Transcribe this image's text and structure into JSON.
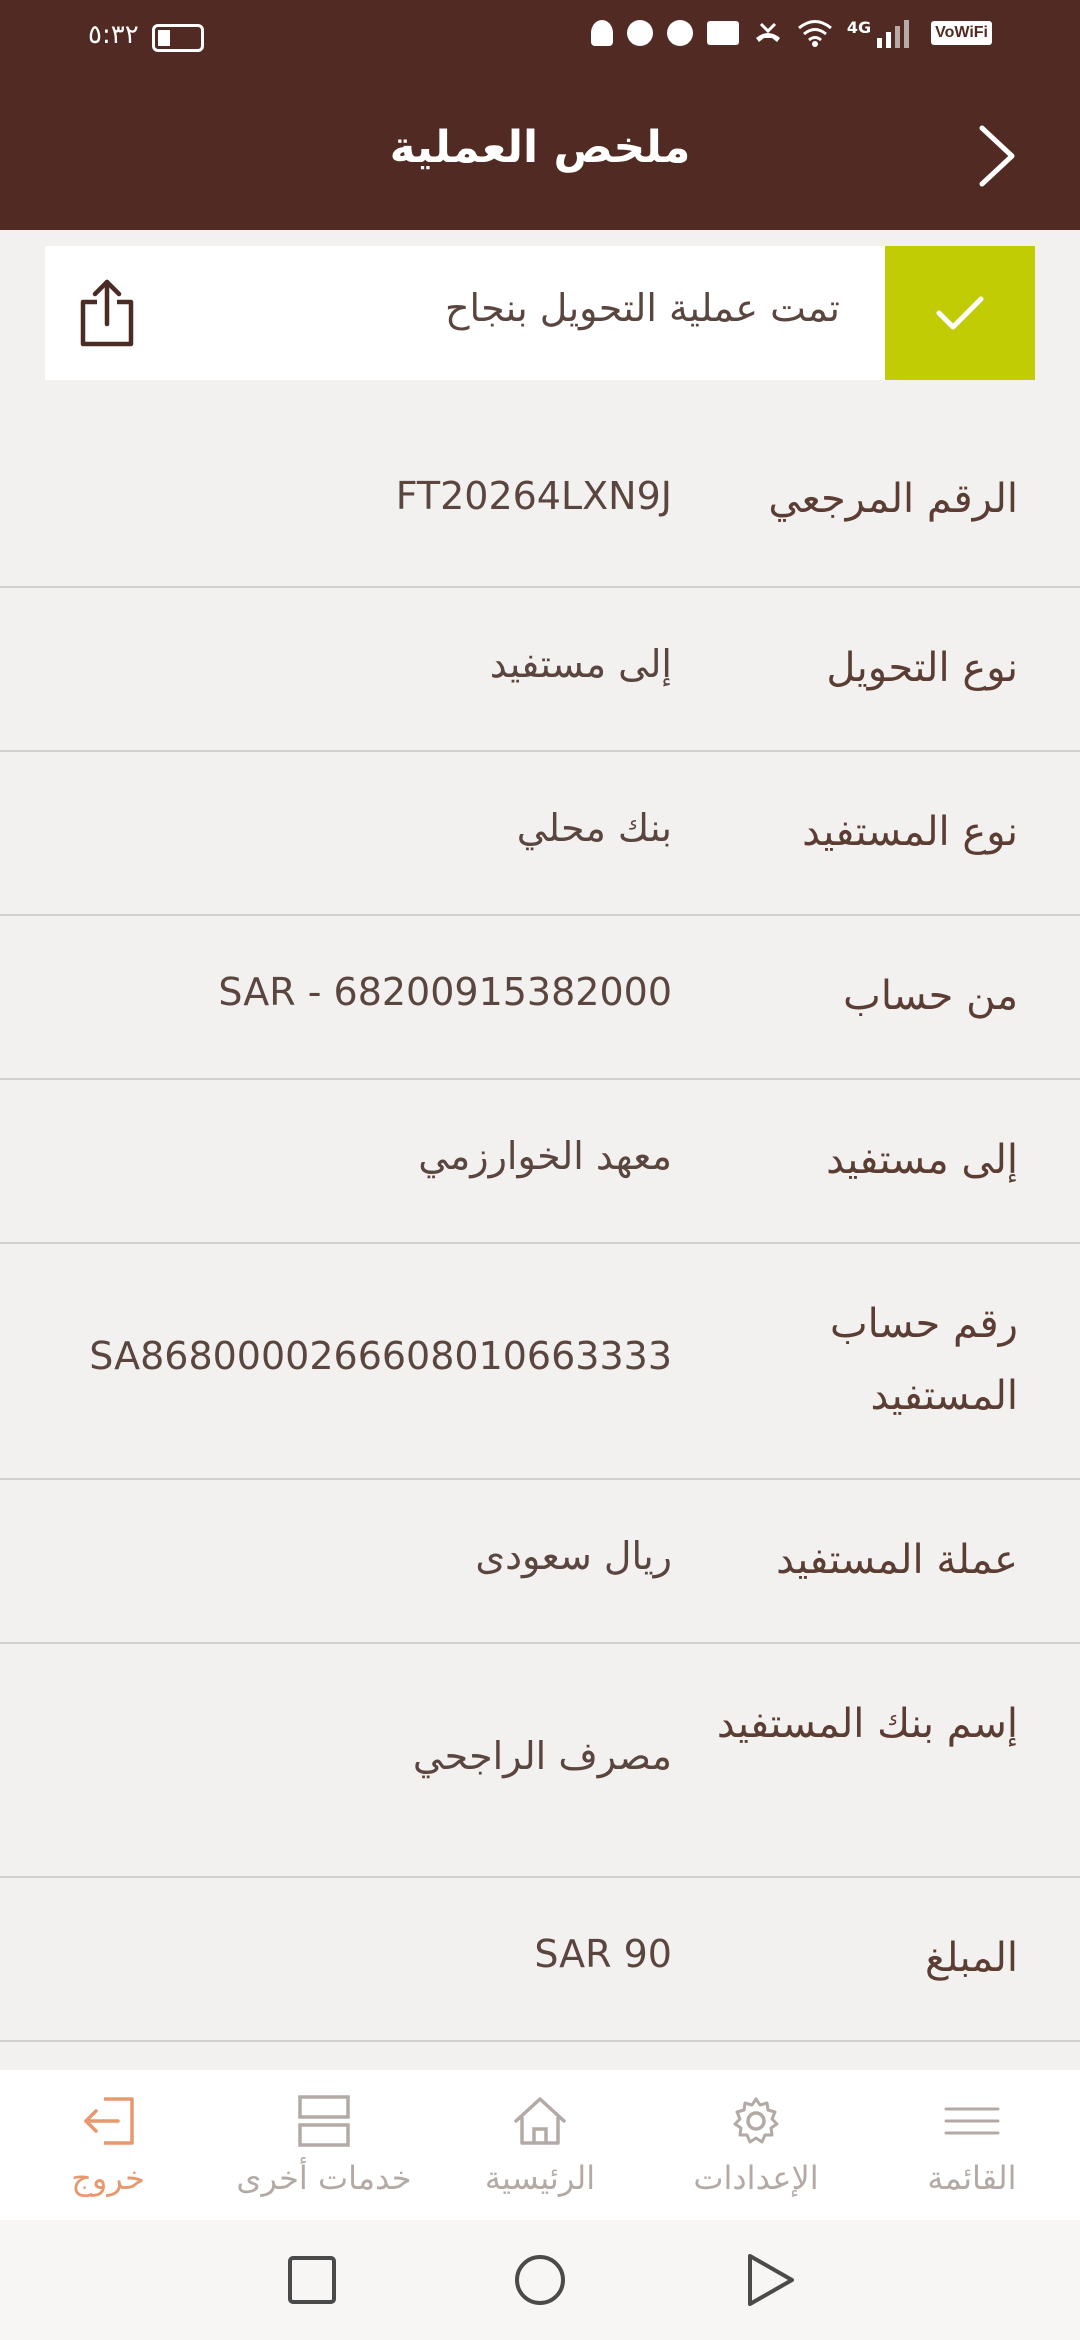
{
  "status_bar": {
    "time": "٥:٣٢",
    "network": "4G",
    "volte": "VoWiFi"
  },
  "header": {
    "title": "ملخص العملية"
  },
  "banner": {
    "message": "تمت عملية التحويل بنجاح",
    "accent_color": "#c2cc04"
  },
  "details": [
    {
      "label": "الرقم المرجعي",
      "value": "FT20264LXN9J"
    },
    {
      "label": "نوع التحويل",
      "value": "إلى مستفيد"
    },
    {
      "label": "نوع المستفيد",
      "value": "بنك محلي"
    },
    {
      "label": "من حساب",
      "value": "SAR - 68200915382000"
    },
    {
      "label": "إلى مستفيد",
      "value": "معهد الخوارزمي"
    },
    {
      "label": "رقم حساب المستفيد",
      "value": "SA8680000266608010663333"
    },
    {
      "label": "عملة المستفيد",
      "value": "ريال سعودى"
    },
    {
      "label": "إسم بنك المستفيد",
      "value": "مصرف الراجحي"
    },
    {
      "label": "المبلغ",
      "value": "SAR 90"
    }
  ],
  "bottom_nav": {
    "items": [
      {
        "label": "خروج",
        "icon": "logout-icon",
        "active": true
      },
      {
        "label": "خدمات أخرى",
        "icon": "services-icon",
        "active": false
      },
      {
        "label": "الرئيسية",
        "icon": "home-icon",
        "active": false
      },
      {
        "label": "الإعدادات",
        "icon": "gear-icon",
        "active": false
      },
      {
        "label": "القائمة",
        "icon": "menu-icon",
        "active": false
      }
    ]
  },
  "colors": {
    "header_bg": "#512b23",
    "active_nav": "#e8986e",
    "inactive_nav": "#b3aaa6"
  }
}
